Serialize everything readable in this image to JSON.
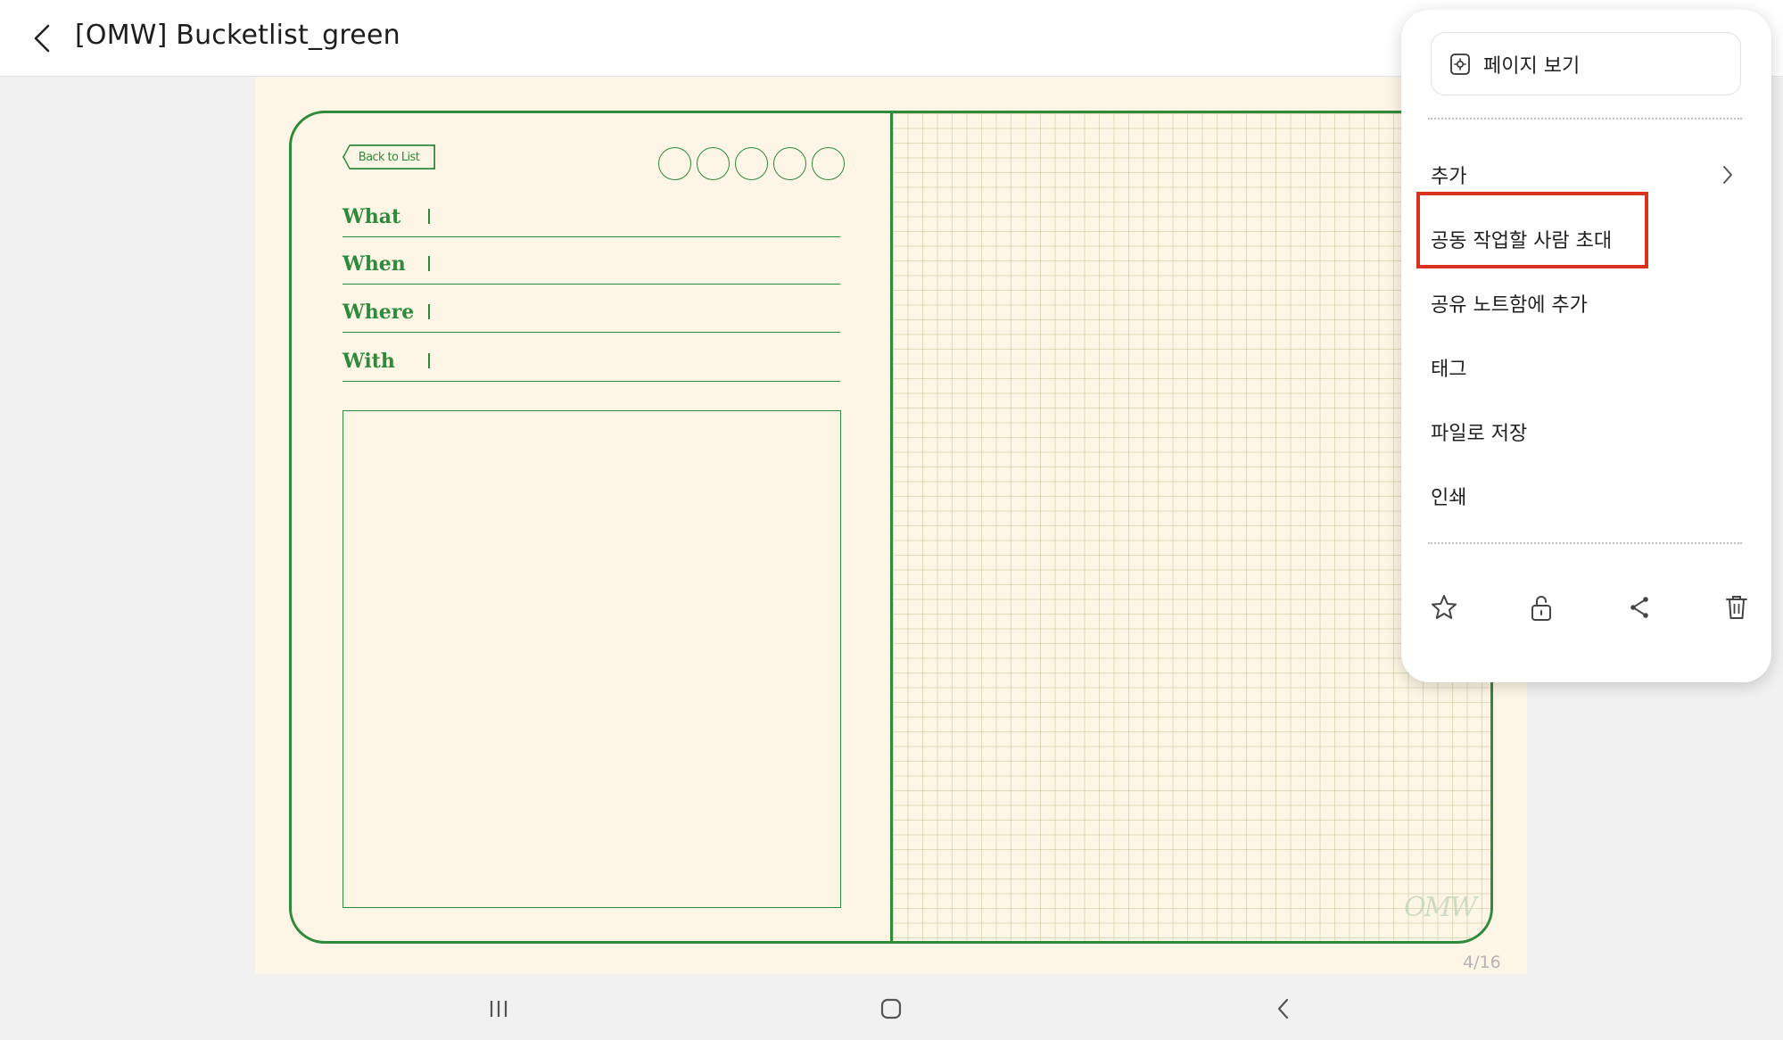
{
  "app": {
    "title": "[OMW] Bucketlist_green",
    "page_counter": "4/16"
  },
  "note": {
    "back_to_list_label": "Back to List",
    "fields": [
      "What",
      "When",
      "Where",
      "With"
    ],
    "logo_text": "OMW"
  },
  "menu": {
    "view_page_label": "페이지 보기",
    "items": [
      {
        "label": "추가",
        "has_submenu": true
      },
      {
        "label": "공동 작업할 사람 초대",
        "highlighted": true
      },
      {
        "label": "공유 노트함에 추가"
      },
      {
        "label": "태그"
      },
      {
        "label": "파일로 저장"
      },
      {
        "label": "인쇄"
      }
    ],
    "actions": [
      "star-icon",
      "unlock-icon",
      "share-icon",
      "trash-icon"
    ],
    "highlight_color": "#d9321f"
  },
  "colors": {
    "accent_green": "#2f8a3c",
    "paper": "#fdf6e6"
  }
}
